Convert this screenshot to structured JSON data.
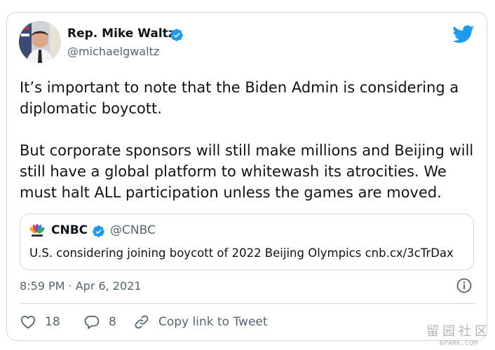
{
  "author": {
    "name": "Rep. Mike Waltz",
    "handle": "@michaelgwaltz",
    "verified": true
  },
  "tweet": {
    "paragraphs": [
      "It’s important to note that the Biden Admin is considering a diplomatic boycott.",
      "But corporate sponsors will still make millions and Beijing will still have a global platform to whitewash its atrocities. We must halt ALL participation unless the games are moved."
    ],
    "timestamp": "8:59 PM · Apr 6, 2021"
  },
  "quoted_tweet": {
    "name": "CNBC",
    "handle": "@CNBC",
    "verified": true,
    "text": "U.S. considering joining boycott of 2022 Beijing Olympics cnb.cx/3cTrDax"
  },
  "actions": {
    "like_count": "18",
    "reply_count": "8",
    "copy_link_label": "Copy link to Tweet"
  },
  "icons": {
    "verified": "verified-badge-icon",
    "twitter": "twitter-bird-icon",
    "info": "info-icon",
    "like": "heart-icon",
    "reply": "reply-icon",
    "link": "link-icon"
  },
  "colors": {
    "twitter_blue": "#1d9bf0",
    "text": "#0f1419",
    "secondary_text": "#536471",
    "border": "#cfd9de"
  },
  "watermark": {
    "glyphs": "留园社区",
    "site": "6PARK.COM"
  }
}
